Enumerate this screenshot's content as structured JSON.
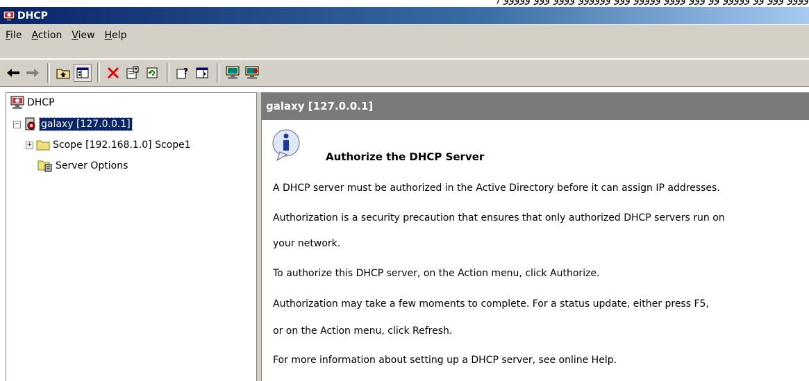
{
  "overlay_text": "ﻭﻭﻭﻭ ﻭﻭﻭ ﻭﻭ ﻭﻭﻭﻭﻭ ﻭﻭ ﻭﻭﻭ ﻭﻭﻭﻭ ﻭﻭﻭﻭﻭ ﻭﻭﻭ ﻭﻭﻭﻭﻭﻭ ﻭﻭﻭﻭ ﻭﻭﻭ ﻭﻭﻭﻭﻭ (",
  "window": {
    "title": "DHCP"
  },
  "menu": [
    "File",
    "Action",
    "View",
    "Help"
  ],
  "toolbar": {
    "buttons": [
      "back-icon",
      "forward-icon",
      "up-one-level-icon",
      "show-hide-console-tree-icon",
      "delete-icon",
      "properties-icon",
      "refresh-icon",
      "help-icon",
      "show-hide-action-pane-icon",
      "server-icon",
      "server-alt-icon"
    ]
  },
  "tree": {
    "root": "DHCP",
    "server": "galaxy [127.0.0.1]",
    "scope": "Scope [192.168.1.0] Scope1",
    "server_options": "Server Options"
  },
  "detail": {
    "header": "galaxy [127.0.0.1]",
    "title": "Authorize the DHCP Server",
    "paragraphs": [
      "A DHCP server must be authorized in the Active Directory before it can assign IP addresses.",
      "Authorization is a security precaution that ensures that only authorized DHCP servers run on",
      "your network.",
      "To authorize this DHCP server, on the Action menu, click Authorize.",
      "Authorization may take a few moments to complete. For a status update, either press F5,",
      "or on the Action menu, click Refresh.",
      "For more information about setting up a DHCP server, see online Help."
    ]
  },
  "colors": {
    "title_bar": "#0a246a",
    "selection": "#0a246a",
    "detail_header": "#7a7a7a",
    "chrome": "#d4d0c8"
  }
}
